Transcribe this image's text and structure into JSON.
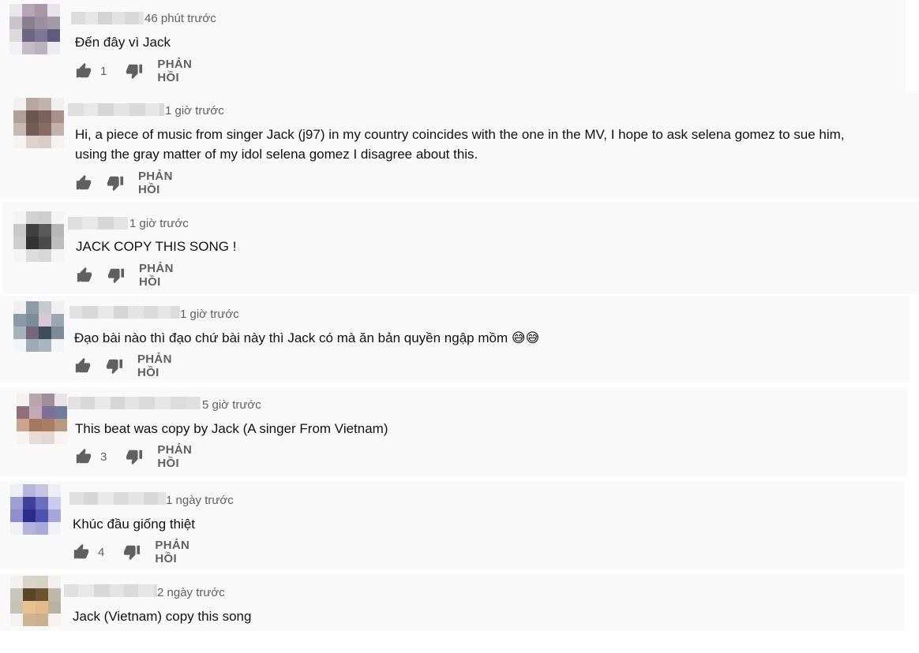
{
  "comments": [
    {
      "time": "46 phút trước",
      "text": "Đến đây vì Jack",
      "likes": "1",
      "reply_label": "PHẢN HỒI"
    },
    {
      "time": "1 giờ trước",
      "text_line1": "Hi, a piece of music from singer Jack (j97) in my country coincides with the one in the MV, I hope to ask selena gomez to sue him,",
      "text_line2": "using the gray matter of my idol selena gomez I disagree about this.",
      "likes": "",
      "reply_label": "PHẢN HỒI"
    },
    {
      "time": "1 giờ trước",
      "text": "JACK COPY THIS SONG !",
      "likes": "",
      "reply_label": "PHẢN HỒI"
    },
    {
      "time": "1 giờ trước",
      "text": "Đạo bài nào thì đạo chứ bài này thì Jack có mà ăn bản quyền ngập mồm",
      "emoji": "😅😅",
      "likes": "",
      "reply_label": "PHẢN HỒI"
    },
    {
      "time": "5 giờ trước",
      "text": "This beat was copy by Jack (A singer From Vietnam)",
      "likes": "3",
      "reply_label": "PHẢN HỒI"
    },
    {
      "time": "1 ngày trước",
      "text": "Khúc đầu giống thiệt",
      "likes": "4",
      "reply_label": "PHẢN HỒI"
    },
    {
      "time": "2 ngày trước",
      "text": "Jack (Vietnam) copy this song"
    }
  ],
  "icons": {
    "like": "thumbs-up-icon",
    "dislike": "thumbs-down-icon"
  },
  "colors": {
    "background_strip": "#f9f9f9",
    "meta_text": "#606060",
    "body_text": "#111111",
    "icon": "#606060"
  }
}
